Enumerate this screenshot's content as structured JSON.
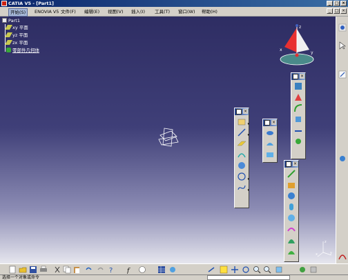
{
  "window": {
    "title": "CATIA V5 - [Part1]",
    "buttons": [
      "_",
      "□",
      "×"
    ]
  },
  "menubar": {
    "items": [
      "开始(S)",
      "ENOVIA V5",
      "文件(F)",
      "编辑(E)",
      "视图(V)",
      "插入(I)",
      "工具(T)",
      "窗口(W)",
      "帮助(H)"
    ],
    "mdi_buttons": [
      "_",
      "□",
      "×"
    ]
  },
  "tree": {
    "root": "Part1",
    "items": [
      "xy 平面",
      "yz 平面",
      "zx 平面",
      "零部件几何体"
    ]
  },
  "compass": {
    "x_label": "x",
    "y_label": "y",
    "z_label": "z"
  },
  "axis_triad": {
    "x_label": "x",
    "y_label": "y",
    "z_label": "z"
  },
  "statusbar": {
    "text": "选择一个对象或命令"
  },
  "colors": {
    "viewport_top": "#2e2d63",
    "viewport_bottom": "#e6e6ee",
    "accent": "#0a246a"
  }
}
